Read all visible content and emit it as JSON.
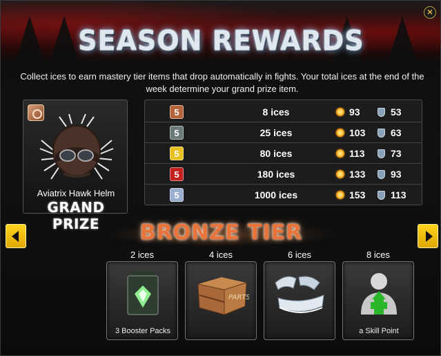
{
  "header": {
    "title": "SEASON REWARDS",
    "close_icon": "close-icon"
  },
  "description": "Collect ices to earn mastery tier items that drop automatically in fights. Your total ices at the end of the week determine your grand prize item.",
  "grand_prize": {
    "item_name": "Aviatrix Hawk Helm",
    "label": "GRAND PRIZE"
  },
  "tiers": [
    {
      "badge": "5",
      "color": "#b5643a",
      "ices": "8 ices",
      "attack": "93",
      "defense": "53"
    },
    {
      "badge": "5",
      "color": "#6a7a7a",
      "ices": "25 ices",
      "attack": "103",
      "defense": "63"
    },
    {
      "badge": "5",
      "color": "#e8c020",
      "ices": "80 ices",
      "attack": "113",
      "defense": "73"
    },
    {
      "badge": "5",
      "color": "#c42020",
      "ices": "180 ices",
      "attack": "133",
      "defense": "93"
    },
    {
      "badge": "5",
      "color": "#9aaed0",
      "ices": "1000 ices",
      "attack": "153",
      "defense": "113"
    }
  ],
  "current_tier": {
    "title": "BRONZE TIER"
  },
  "rewards": [
    {
      "cost": "2 ices",
      "label": "3 Booster Packs"
    },
    {
      "cost": "4 ices",
      "label": ""
    },
    {
      "cost": "6 ices",
      "label": ""
    },
    {
      "cost": "8 ices",
      "label": "a Skill Point"
    }
  ],
  "colors": {
    "accent": "#e8743a",
    "arrow": "#ffd21e"
  }
}
